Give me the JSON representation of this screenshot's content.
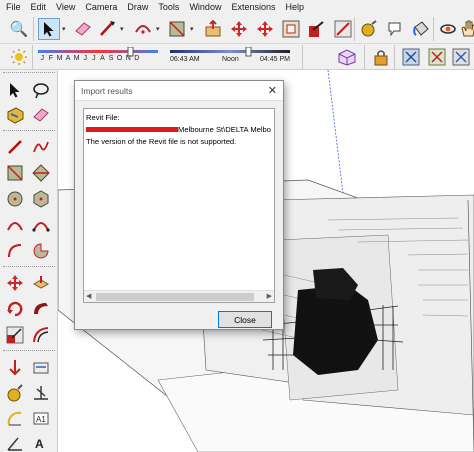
{
  "menu": [
    "File",
    "Edit",
    "View",
    "Camera",
    "Draw",
    "Tools",
    "Window",
    "Extensions",
    "Help"
  ],
  "toolbar": {
    "icons": [
      "zoom-icon",
      "select-icon",
      "eraser-icon",
      "line-icon",
      "arc-icon",
      "shape-icon",
      "push-pull-icon",
      "move-icon",
      "rotate-icon",
      "offset-icon",
      "tape-icon",
      "paint-icon",
      "orbit-icon",
      "pan-icon",
      "zoom-extents-icon",
      "layer-icon"
    ]
  },
  "shadows": {
    "months": [
      "J",
      "F",
      "M",
      "A",
      "M",
      "J",
      "J",
      "A",
      "S",
      "O",
      "N",
      "D"
    ],
    "time_start": "06:43 AM",
    "time_noon": "Noon",
    "time_end": "04:45 PM",
    "date_fill": 0.78,
    "time_fill": 0.66
  },
  "dialog": {
    "title": "Import results",
    "file_label": "Revit File:",
    "file_path_visible": "Melbourne St\\DELTA Melbo",
    "message": "The version of the Revit file is not supported.",
    "close_label": "Close",
    "accent": "#0078d7"
  },
  "colors": {
    "menubar": "#f0f0f0",
    "redaction": "#e01818",
    "axis_red": "#e05050",
    "axis_green": "#2fb02f",
    "axis_blue": "#3f5fd8"
  }
}
